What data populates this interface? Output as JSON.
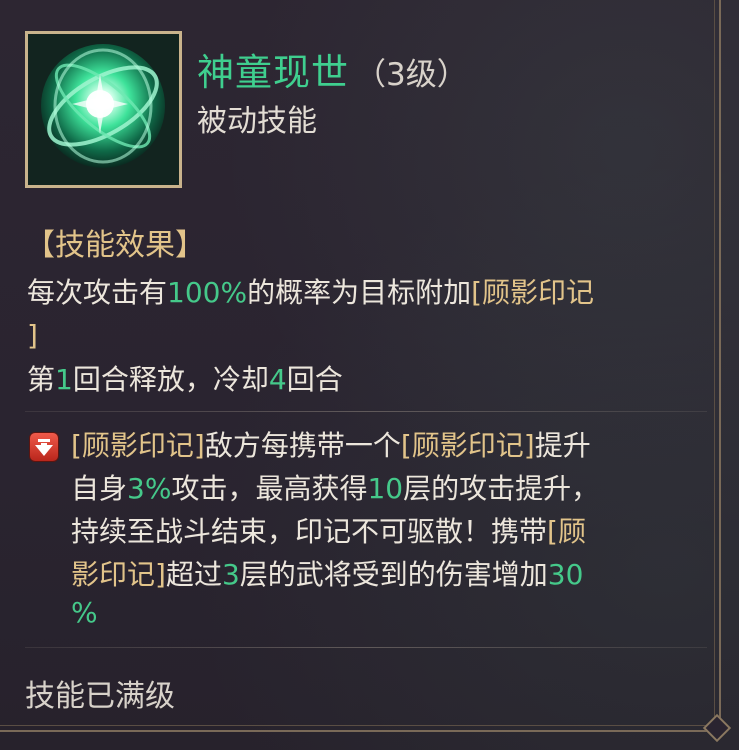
{
  "skill": {
    "name": "神童现世",
    "level": "（3级）",
    "type": "被动技能",
    "icon": "green-energy-orb-icon"
  },
  "effect": {
    "header": "【技能效果】",
    "line1": {
      "a": "每次攻击有",
      "b": "100%",
      "c": "的概率为目标附加",
      "d": "[顾影印记"
    },
    "line2": {
      "a": "]"
    },
    "line3": {
      "a": "第",
      "b": "1",
      "c": "回合释放，冷却",
      "d": "4",
      "e": "回合"
    }
  },
  "mark": {
    "icon": "debuff-arrow-icon",
    "line1": {
      "a": "[顾影印记]",
      "b": "敌方每携带一个",
      "c": "[顾影印记]",
      "d": "提升"
    },
    "line2": {
      "a": "自身",
      "b": "3%",
      "c": "攻击，最高获得",
      "d": "10",
      "e": "层的攻击提升，"
    },
    "line3": {
      "a": "持续至战斗结束，印记不可驱散！携带",
      "b": "[顾"
    },
    "line4": {
      "a": "影印记]",
      "b": "超过",
      "c": "3",
      "d": "层的武将受到的伤害增加",
      "e": "30"
    },
    "line5": {
      "a": "%"
    }
  },
  "footer": {
    "status": "技能已满级"
  },
  "colors": {
    "highlight": "#45c98a",
    "keyword": "#e2c48a",
    "title": "#3fcf8f",
    "frame": "#c9b38c"
  }
}
